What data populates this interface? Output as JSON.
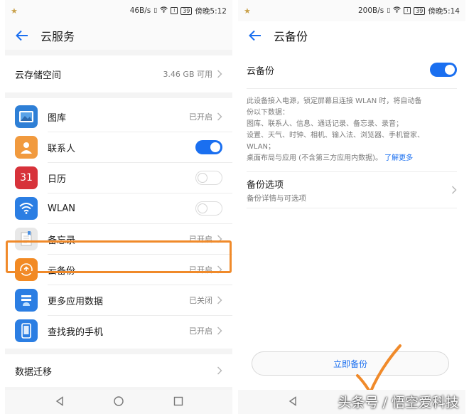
{
  "left": {
    "status": {
      "net_speed": "46B/s",
      "time": "傍晚5:12",
      "battery": "39"
    },
    "header": {
      "title": "云服务"
    },
    "storage": {
      "label": "云存储空间",
      "value": "3.46 GB 可用"
    },
    "apps": [
      {
        "label": "图库",
        "status": "已开启",
        "control": "chevron",
        "icon": "gallery-icon",
        "color": "#2e7fd6"
      },
      {
        "label": "联系人",
        "status": "",
        "control": "toggle-on",
        "icon": "contacts-icon",
        "color": "#f19a3e"
      },
      {
        "label": "日历",
        "status": "",
        "control": "toggle-off",
        "icon": "calendar-icon",
        "color": "#d7323a",
        "icon_text": "31"
      },
      {
        "label": "WLAN",
        "status": "",
        "control": "toggle-off",
        "icon": "wifi-icon",
        "color": "#2b7ee3"
      },
      {
        "label": "备忘录",
        "status": "已开启",
        "control": "chevron",
        "icon": "notepad-icon",
        "color": "#e8e8e8"
      },
      {
        "label": "云备份",
        "status": "已开启",
        "control": "chevron",
        "icon": "cloud-backup-icon",
        "color": "#f28a24"
      },
      {
        "label": "更多应用数据",
        "status": "已关闭",
        "control": "chevron",
        "icon": "app-data-icon",
        "color": "#2b7ee3"
      },
      {
        "label": "查找我的手机",
        "status": "已开启",
        "control": "chevron",
        "icon": "find-phone-icon",
        "color": "#2b7ee3"
      }
    ],
    "migration": {
      "label": "数据迁移"
    }
  },
  "right": {
    "status": {
      "net_speed": "200B/s",
      "time": "傍晚5:14",
      "battery": "39"
    },
    "header": {
      "title": "云备份"
    },
    "toggle_row": {
      "label": "云备份",
      "state": "on"
    },
    "description": {
      "lines": [
        "此设备接入电源，锁定屏幕且连接 WLAN 时，将自动备",
        "份以下数据：",
        "图库、联系人、信息、通话记录、备忘录、录音；",
        "设置、天气、时钟、相机、输入法、浏览器、手机管家、",
        "WLAN；"
      ],
      "last_line": "桌面布局与应用 (不含第三方应用内数据)。",
      "learn_more": "了解更多"
    },
    "options": {
      "title": "备份选项",
      "subtitle": "备份详情与可选项"
    },
    "backup_button": "立即备份"
  },
  "watermark": "头条号 / 悟空爱科技",
  "colors": {
    "accent": "#1a6ff0",
    "highlight": "#f08a2a"
  }
}
